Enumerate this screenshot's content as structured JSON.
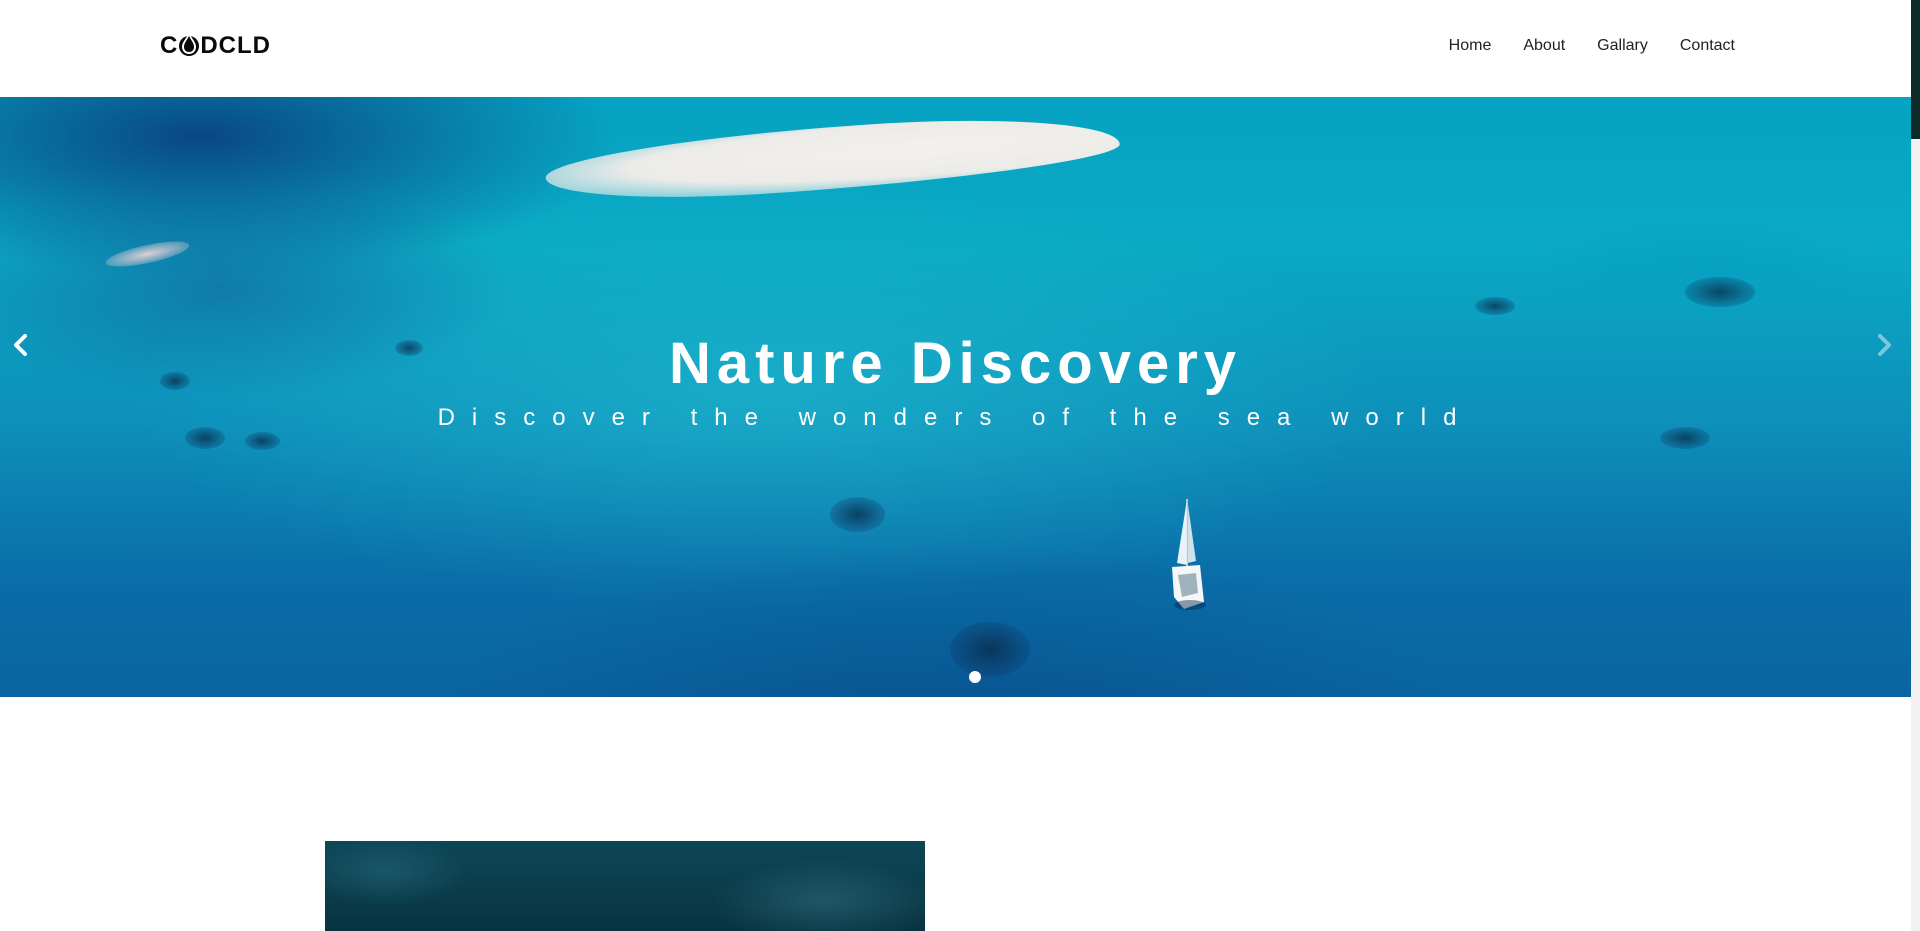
{
  "header": {
    "logo_prefix": "C",
    "logo_suffix": "DCLD",
    "logo_icon": "droplet-icon",
    "nav": {
      "home": "Home",
      "about": "About",
      "gallary": "Gallary",
      "contact": "Contact"
    }
  },
  "hero": {
    "title": "Nature Discovery",
    "subtitle": "Discover the wonders of the sea world",
    "prev_icon": "chevron-left-icon",
    "next_icon": "chevron-right-icon",
    "slide_count": 1,
    "active_slide": 1
  },
  "colors": {
    "header_bg": "#ffffff",
    "nav_text": "#222222",
    "hero_text": "#ffffff",
    "sea_light": "#0aa9c4",
    "sea_deep": "#0a64a0",
    "scrollbar_thumb": "#0c2b27"
  }
}
